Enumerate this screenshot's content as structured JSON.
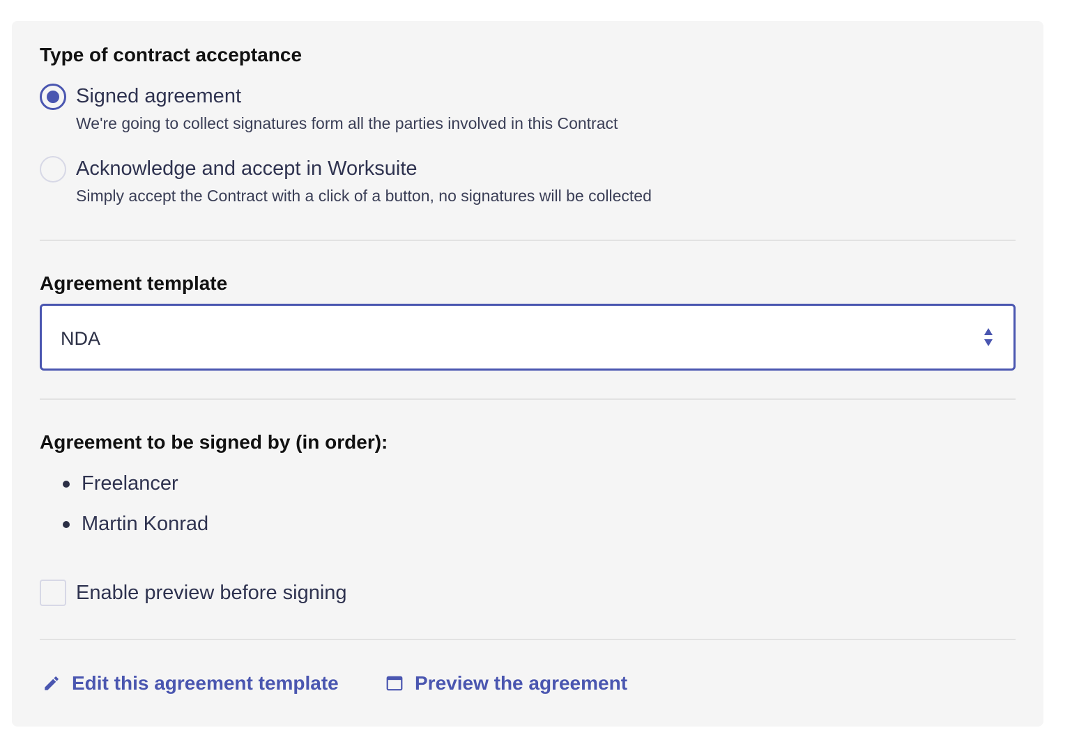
{
  "acceptance": {
    "title": "Type of contract acceptance",
    "options": [
      {
        "label": "Signed agreement",
        "description": "We're going to collect signatures form all the parties involved in this Contract",
        "selected": true
      },
      {
        "label": "Acknowledge and accept in Worksuite",
        "description": "Simply accept the Contract with a click of a button, no signatures will be collected",
        "selected": false
      }
    ]
  },
  "template": {
    "title": "Agreement template",
    "selected_value": "NDA"
  },
  "signers": {
    "title": "Agreement to be signed by (in order):",
    "items": [
      "Freelancer",
      "Martin Konrad"
    ]
  },
  "preview_option": {
    "label": "Enable preview before signing",
    "checked": false
  },
  "actions": {
    "edit_label": "Edit this agreement template",
    "edit_icon": "pencil-icon",
    "preview_label": "Preview the agreement",
    "preview_icon": "browser-window-icon"
  },
  "colors": {
    "accent": "#4a56b0",
    "panel_bg": "#f5f5f5",
    "text": "#2f3350"
  }
}
